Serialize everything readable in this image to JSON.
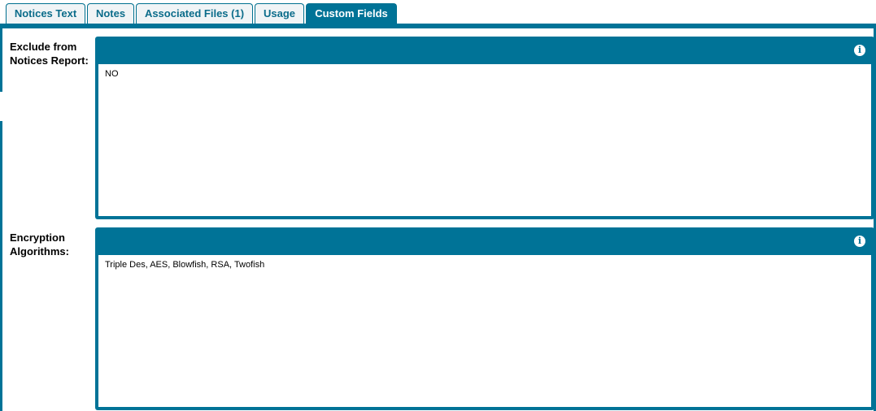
{
  "tabs": [
    {
      "label": "Notices Text"
    },
    {
      "label": "Notes"
    },
    {
      "label": "Associated Files (1)"
    },
    {
      "label": "Usage"
    },
    {
      "label": "Custom Fields"
    }
  ],
  "fields": [
    {
      "label": "Exclude from Notices Report:",
      "value": "NO",
      "info_icon": "info-icon"
    },
    {
      "label": "Encryption Algorithms:",
      "value": "Triple Des, AES, Blowfish, RSA, Twofish",
      "info_icon": "info-icon"
    }
  ],
  "colors": {
    "accent": "#007397",
    "tab_text": "#0b6c8a"
  }
}
